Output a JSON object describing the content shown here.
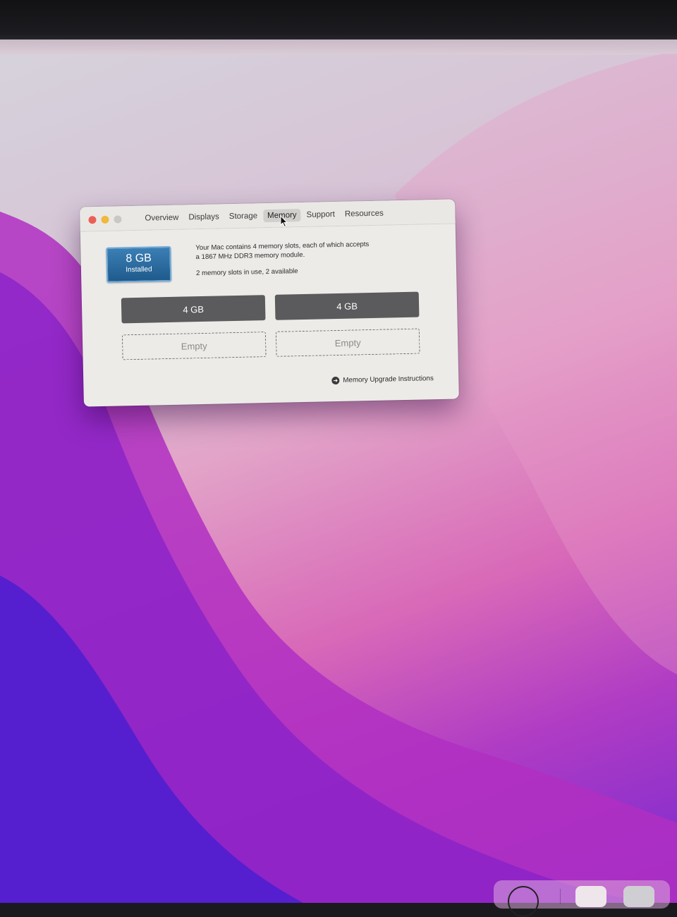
{
  "window": {
    "tabs": [
      {
        "label": "Overview",
        "active": false
      },
      {
        "label": "Displays",
        "active": false
      },
      {
        "label": "Storage",
        "active": false
      },
      {
        "label": "Memory",
        "active": true
      },
      {
        "label": "Support",
        "active": false
      },
      {
        "label": "Resources",
        "active": false
      }
    ],
    "badge": {
      "size": "8 GB",
      "label": "Installed"
    },
    "description_line1": "Your Mac contains 4 memory slots, each of which accepts",
    "description_line2": "a 1867 MHz DDR3 memory module.",
    "slots_summary": "2 memory slots in use, 2 available",
    "slots": [
      {
        "label": "4 GB",
        "state": "used"
      },
      {
        "label": "4 GB",
        "state": "used"
      },
      {
        "label": "Empty",
        "state": "empty"
      },
      {
        "label": "Empty",
        "state": "empty"
      }
    ],
    "upgrade_link": "Memory Upgrade Instructions"
  },
  "colors": {
    "close": "#ec5f56",
    "minimize": "#f1b83a",
    "zoom": "#c9c8c5",
    "badge": "#1f5a8c",
    "slot_used": "#5b5b5d"
  },
  "icons": {
    "link": "arrow-circle-right-icon",
    "cursor": "pointer-icon"
  }
}
